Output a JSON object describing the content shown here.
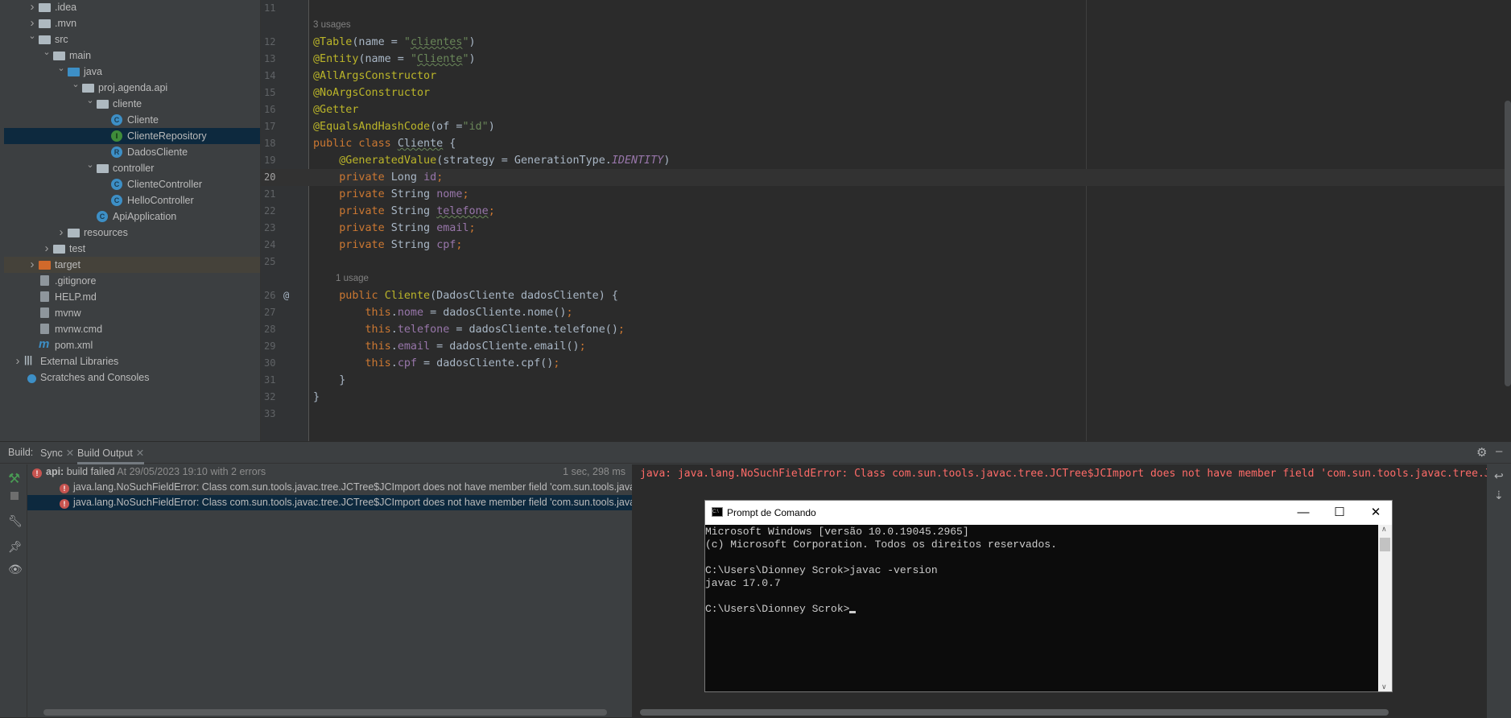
{
  "project_tree": {
    "items": [
      {
        "label": ".idea",
        "level": 0,
        "expanded": false,
        "icon": "folder-icon"
      },
      {
        "label": ".mvn",
        "level": 0,
        "expanded": false,
        "icon": "folder-icon"
      },
      {
        "label": "src",
        "level": 0,
        "expanded": true,
        "icon": "folder-icon"
      },
      {
        "label": "main",
        "level": 1,
        "expanded": true,
        "icon": "folder-icon"
      },
      {
        "label": "java",
        "level": 2,
        "expanded": true,
        "icon": "source-folder-icon"
      },
      {
        "label": "proj.agenda.api",
        "level": 3,
        "expanded": true,
        "icon": "package-icon"
      },
      {
        "label": "cliente",
        "level": 4,
        "expanded": true,
        "icon": "package-icon"
      },
      {
        "label": "Cliente",
        "level": 5,
        "icon": "class-icon",
        "badge": "C"
      },
      {
        "label": "ClienteRepository",
        "level": 5,
        "icon": "interface-icon",
        "badge": "I",
        "selected": true
      },
      {
        "label": "DadosCliente",
        "level": 5,
        "icon": "record-icon",
        "badge": "R"
      },
      {
        "label": "controller",
        "level": 4,
        "expanded": true,
        "icon": "package-icon"
      },
      {
        "label": "ClienteController",
        "level": 5,
        "icon": "class-icon",
        "badge": "C"
      },
      {
        "label": "HelloController",
        "level": 5,
        "icon": "class-icon",
        "badge": "C"
      },
      {
        "label": "ApiApplication",
        "level": 4,
        "icon": "spring-boot-class-icon",
        "badge": "C"
      },
      {
        "label": "resources",
        "level": 2,
        "expanded": false,
        "icon": "resources-folder-icon"
      },
      {
        "label": "test",
        "level": 1,
        "expanded": false,
        "icon": "folder-icon"
      },
      {
        "label": "target",
        "level": 0,
        "expanded": false,
        "icon": "excluded-folder-icon",
        "highlight": true
      },
      {
        "label": ".gitignore",
        "level": 0,
        "icon": "gitignore-file-icon"
      },
      {
        "label": "HELP.md",
        "level": 0,
        "icon": "markdown-file-icon"
      },
      {
        "label": "mvnw",
        "level": 0,
        "icon": "shell-file-icon"
      },
      {
        "label": "mvnw.cmd",
        "level": 0,
        "icon": "text-file-icon"
      },
      {
        "label": "pom.xml",
        "level": 0,
        "icon": "maven-icon"
      },
      {
        "label": "External Libraries",
        "level": -1,
        "expanded": false,
        "icon": "libraries-icon"
      },
      {
        "label": "Scratches and Consoles",
        "level": -1,
        "icon": "scratches-icon"
      }
    ]
  },
  "editor": {
    "current_line": "20",
    "lines": [
      {
        "n": "11",
        "tokens": []
      },
      {
        "usage": "3 usages"
      },
      {
        "n": "12",
        "tokens": [
          [
            "@Table",
            "ann"
          ],
          [
            "(name = ",
            "txt"
          ],
          [
            "\"",
            "str"
          ],
          [
            "clientes",
            "str wavy"
          ],
          [
            "\"",
            "str"
          ],
          [
            ")",
            "txt"
          ]
        ]
      },
      {
        "n": "13",
        "tokens": [
          [
            "@Entity",
            "ann"
          ],
          [
            "(name = ",
            "txt"
          ],
          [
            "\"",
            "str"
          ],
          [
            "Cliente",
            "str wavy"
          ],
          [
            "\"",
            "str"
          ],
          [
            ")",
            "txt"
          ]
        ]
      },
      {
        "n": "14",
        "tokens": [
          [
            "@AllArgsConstructor",
            "ann"
          ]
        ]
      },
      {
        "n": "15",
        "tokens": [
          [
            "@NoArgsConstructor",
            "ann"
          ]
        ]
      },
      {
        "n": "16",
        "tokens": [
          [
            "@Getter",
            "ann"
          ]
        ]
      },
      {
        "n": "17",
        "tokens": [
          [
            "@EqualsAndHashCode",
            "ann"
          ],
          [
            "(of =",
            "txt"
          ],
          [
            "\"id\"",
            "str"
          ],
          [
            ")",
            "txt"
          ]
        ]
      },
      {
        "n": "18",
        "tokens": [
          [
            "public class ",
            "kw"
          ],
          [
            "Cliente",
            "txt wavy"
          ],
          [
            " {",
            "txt"
          ]
        ]
      },
      {
        "n": "19",
        "tokens": [
          [
            "    ",
            "txt"
          ],
          [
            "@GeneratedValue",
            "ann"
          ],
          [
            "(strategy = GenerationType.",
            "txt"
          ],
          [
            "IDENTITY",
            "ital"
          ],
          [
            ")",
            "txt"
          ]
        ]
      },
      {
        "n": "20",
        "tokens": [
          [
            "    private ",
            "kw"
          ],
          [
            "Long ",
            "txt"
          ],
          [
            "id",
            "fld"
          ],
          [
            ";",
            "kw"
          ]
        ]
      },
      {
        "n": "21",
        "tokens": [
          [
            "    private ",
            "kw"
          ],
          [
            "String ",
            "txt"
          ],
          [
            "nome",
            "fld"
          ],
          [
            ";",
            "kw"
          ]
        ]
      },
      {
        "n": "22",
        "tokens": [
          [
            "    private ",
            "kw"
          ],
          [
            "String ",
            "txt"
          ],
          [
            "telefone",
            "fld wavy"
          ],
          [
            ";",
            "kw"
          ]
        ]
      },
      {
        "n": "23",
        "tokens": [
          [
            "    private ",
            "kw"
          ],
          [
            "String ",
            "txt"
          ],
          [
            "email",
            "fld"
          ],
          [
            ";",
            "kw"
          ]
        ]
      },
      {
        "n": "24",
        "tokens": [
          [
            "    private ",
            "kw"
          ],
          [
            "String ",
            "txt"
          ],
          [
            "cpf",
            "fld"
          ],
          [
            ";",
            "kw"
          ]
        ]
      },
      {
        "n": "25",
        "tokens": []
      },
      {
        "usage": "1 usage",
        "indent": true
      },
      {
        "n": "26",
        "gutter_mark": "@",
        "tokens": [
          [
            "    public ",
            "kw"
          ],
          [
            "Cliente",
            "ann"
          ],
          [
            "(DadosCliente dadosCliente) {",
            "txt"
          ]
        ]
      },
      {
        "n": "27",
        "tokens": [
          [
            "        this",
            "kw"
          ],
          [
            ".",
            "txt"
          ],
          [
            "nome",
            "fld"
          ],
          [
            " = dadosCliente.nome()",
            "txt"
          ],
          [
            ";",
            "kw"
          ]
        ]
      },
      {
        "n": "28",
        "tokens": [
          [
            "        this",
            "kw"
          ],
          [
            ".",
            "txt"
          ],
          [
            "telefone",
            "fld"
          ],
          [
            " = dadosCliente.telefone()",
            "txt"
          ],
          [
            ";",
            "kw"
          ]
        ]
      },
      {
        "n": "29",
        "tokens": [
          [
            "        this",
            "kw"
          ],
          [
            ".",
            "txt"
          ],
          [
            "email",
            "fld"
          ],
          [
            " = dadosCliente.email()",
            "txt"
          ],
          [
            ";",
            "kw"
          ]
        ]
      },
      {
        "n": "30",
        "tokens": [
          [
            "        this",
            "kw"
          ],
          [
            ".",
            "txt"
          ],
          [
            "cpf",
            "fld"
          ],
          [
            " = dadosCliente.cpf()",
            "txt"
          ],
          [
            ";",
            "kw"
          ]
        ]
      },
      {
        "n": "31",
        "tokens": [
          [
            "    }",
            "txt"
          ]
        ]
      },
      {
        "n": "32",
        "tokens": [
          [
            "}",
            "txt"
          ]
        ]
      },
      {
        "n": "33",
        "tokens": []
      }
    ]
  },
  "build": {
    "label": "Build:",
    "tabs": [
      {
        "label": "Sync"
      },
      {
        "label": "Build Output",
        "active": true
      }
    ],
    "summary": {
      "project": "api:",
      "status": "build failed",
      "detail": "At 29/05/2023 19:10 with 2 errors",
      "duration": "1 sec, 298 ms"
    },
    "errors": [
      "java.lang.NoSuchFieldError: Class com.sun.tools.javac.tree.JCTree$JCImport does not have member field 'com.sun.tools.javac.tree.JCTree qualid'",
      "java.lang.NoSuchFieldError: Class com.sun.tools.javac.tree.JCTree$JCImport does not have member field 'com.sun.tools.javac.tree.JCTree qualid'"
    ],
    "console_text": "java: java.lang.NoSuchFieldError: Class com.sun.tools.javac.tree.JCTree$JCImport does not have member field 'com.sun.tools.javac.tree.JCTree qualid'"
  },
  "cmd_window": {
    "title": "Prompt de Comando",
    "lines": [
      "Microsoft Windows [versão 10.0.19045.2965]",
      "(c) Microsoft Corporation. Todos os direitos reservados.",
      "",
      "C:\\Users\\Dionney Scrok>javac -version",
      "javac 17.0.7",
      "",
      "C:\\Users\\Dionney Scrok>"
    ]
  },
  "colors": {
    "error": "#FF6B68",
    "selection": "#0D293E",
    "annotation": "#BBB529",
    "keyword": "#CC7832",
    "string": "#6A8759",
    "field": "#9876AA"
  }
}
